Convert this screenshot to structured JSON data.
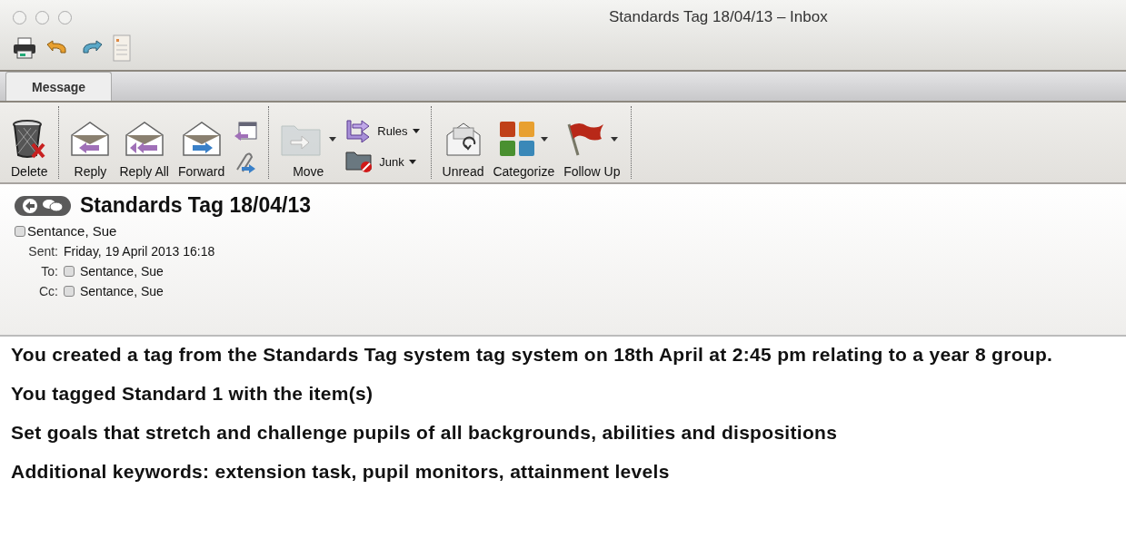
{
  "window": {
    "title": "Standards Tag 18/04/13 – Inbox"
  },
  "tabs": [
    {
      "label": "Message",
      "selected": true
    }
  ],
  "ribbon": {
    "groups": [
      {
        "items": [
          {
            "kind": "large",
            "label": "Delete"
          }
        ]
      },
      {
        "items": [
          {
            "kind": "large",
            "label": "Reply"
          },
          {
            "kind": "large",
            "label": "Reply All"
          },
          {
            "kind": "large",
            "label": "Forward"
          },
          {
            "kind": "icons"
          }
        ]
      },
      {
        "items": [
          {
            "kind": "large",
            "label": "Move",
            "menu": true
          },
          {
            "kind": "stack",
            "buttons": [
              {
                "label": "Rules",
                "menu": true
              },
              {
                "label": "Junk",
                "menu": true
              }
            ]
          }
        ]
      },
      {
        "items": [
          {
            "kind": "large",
            "label": "Unread"
          },
          {
            "kind": "large",
            "label": "Categorize",
            "menu": true
          },
          {
            "kind": "large",
            "label": "Follow Up",
            "menu": true
          }
        ]
      }
    ]
  },
  "message": {
    "subject": "Standards Tag 18/04/13",
    "from": "Sentance, Sue",
    "fields": [
      {
        "label": "Sent:",
        "value": "Friday, 19 April 2013 16:18",
        "kind": "text"
      },
      {
        "label": "To:",
        "value": "Sentance, Sue",
        "kind": "contact"
      },
      {
        "label": "Cc:",
        "value": "Sentance, Sue",
        "kind": "contact"
      }
    ]
  },
  "body": [
    "You created a tag from the Standards Tag system tag system on 18th April at 2:45 pm relating to a year 8 group.",
    "You tagged Standard 1 with the item(s)",
    "Set goals that stretch and challenge pupils of all backgrounds, abilities and dispositions",
    "Additional keywords: extension task,  pupil monitors,  attainment levels"
  ]
}
